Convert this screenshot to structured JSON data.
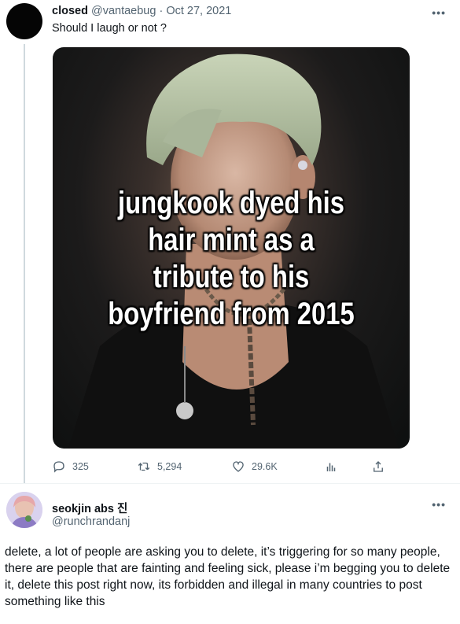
{
  "tweet": {
    "display_name": "closed",
    "handle": "@vantaebug",
    "separator": "·",
    "date": "Oct 27, 2021",
    "text": "Should I laugh or not ?",
    "more_label": "•••",
    "image_caption_lines": [
      "jungkook dyed his",
      "hair mint as a",
      "tribute to his",
      "boyfriend from 2015"
    ],
    "actions": {
      "replies": "325",
      "retweets": "5,294",
      "likes": "29.6K"
    }
  },
  "reply": {
    "display_name": "seokjin abs 진",
    "handle": "@runchrandanj",
    "more_label": "•••",
    "text": "delete, a lot of people are asking you to delete, it’s triggering for so many people, there are people that are fainting and feeling sick, please i’m begging you to delete it, delete this post right now, its forbidden and illegal in many countries to post something like this"
  },
  "colors": {
    "text_primary": "#0f1419",
    "text_secondary": "#536471",
    "thread_line": "#cfd9de",
    "hair_mint": "#b7c4a6"
  },
  "icons": [
    "reply-icon",
    "retweet-icon",
    "like-icon",
    "analytics-icon",
    "share-icon"
  ]
}
